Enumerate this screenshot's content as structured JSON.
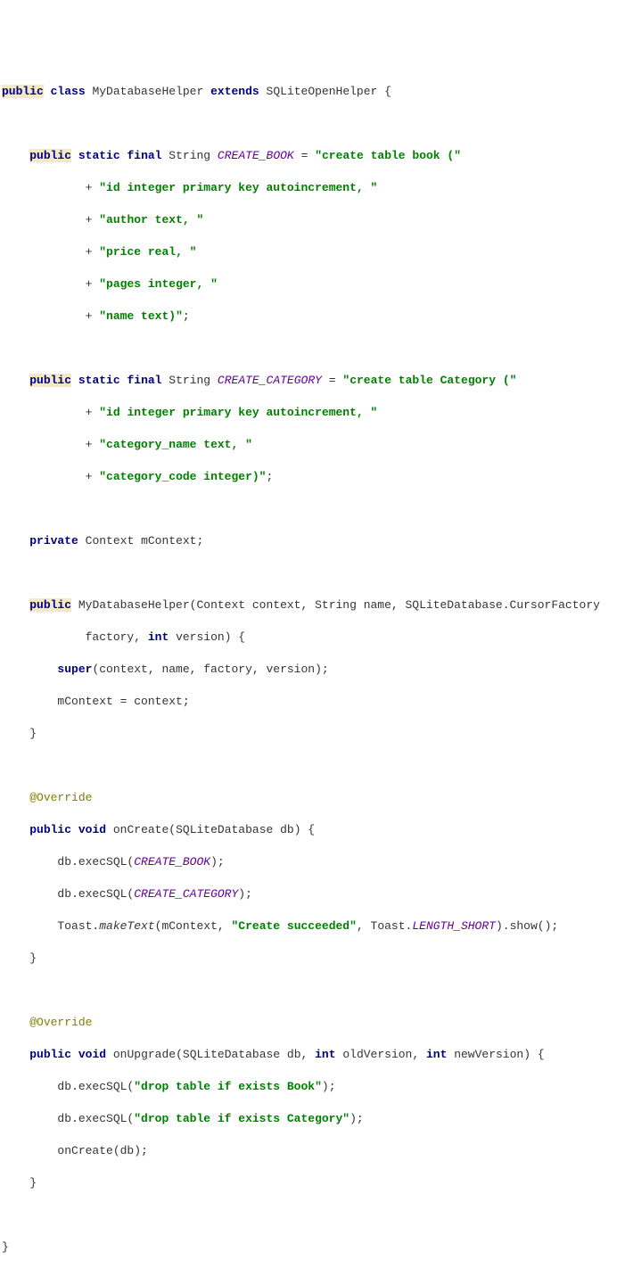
{
  "l1": {
    "public": "public",
    "class": "class",
    "name": "MyDatabaseHelper",
    "extends": "extends",
    "parent": "SQLiteOpenHelper",
    "brace": "{"
  },
  "l3": {
    "public": "public",
    "static": "static",
    "final": "final",
    "type": "String",
    "const": "CREATE_BOOK",
    "eq": "=",
    "s": "\"create table book (\""
  },
  "l4": {
    "plus": "+",
    "s": "\"id integer primary key autoincrement, \""
  },
  "l5": {
    "plus": "+",
    "s": "\"author text, \""
  },
  "l6": {
    "plus": "+",
    "s": "\"price real, \""
  },
  "l7": {
    "plus": "+",
    "s": "\"pages integer, \""
  },
  "l8": {
    "plus": "+",
    "s": "\"name text)\"",
    "semi": ";"
  },
  "l10": {
    "public": "public",
    "static": "static",
    "final": "final",
    "type": "String",
    "const": "CREATE_CATEGORY",
    "eq": "=",
    "s": "\"create table Category (\""
  },
  "l11": {
    "plus": "+",
    "s": "\"id integer primary key autoincrement, \""
  },
  "l12": {
    "plus": "+",
    "s": "\"category_name text, \""
  },
  "l13": {
    "plus": "+",
    "s": "\"category_code integer)\"",
    "semi": ";"
  },
  "l15": {
    "private": "private",
    "type": "Context",
    "name": "mContext;"
  },
  "l17": {
    "public": "public",
    "sig1": "MyDatabaseHelper(Context context, String name, SQLiteDatabase.CursorFactory"
  },
  "l18": {
    "sig2": "factory,",
    "int": "int",
    "rest": "version) {"
  },
  "l19": {
    "super": "super",
    "rest": "(context, name, factory, version);"
  },
  "l20": {
    "rest": "mContext = context;"
  },
  "l21": {
    "brace": "}"
  },
  "l23": {
    "ann": "@Override"
  },
  "l24": {
    "public": "public",
    "void": "void",
    "rest": "onCreate(SQLiteDatabase db) {"
  },
  "l25": {
    "pre": "db.execSQL(",
    "const": "CREATE_BOOK",
    "post": ");"
  },
  "l26": {
    "pre": "db.execSQL(",
    "const": "CREATE_CATEGORY",
    "post": ");"
  },
  "l27": {
    "pre": "Toast.",
    "make": "makeText",
    "open": "(mContext, ",
    "s": "\"Create succeeded\"",
    "mid": ", Toast.",
    "len": "LENGTH_SHORT",
    "post": ").show();"
  },
  "l28": {
    "brace": "}"
  },
  "l30": {
    "ann": "@Override"
  },
  "l31": {
    "public": "public",
    "void": "void",
    "sig1": "onUpgrade(SQLiteDatabase db,",
    "int1": "int",
    "old": "oldVersion,",
    "int2": "int",
    "new": "newVersion) {"
  },
  "l32": {
    "pre": "db.execSQL(",
    "s": "\"drop table if exists Book\"",
    "post": ");"
  },
  "l33": {
    "pre": "db.execSQL(",
    "s": "\"drop table if exists Category\"",
    "post": ");"
  },
  "l34": {
    "rest": "onCreate(db);"
  },
  "l35": {
    "brace": "}"
  },
  "l37": {
    "brace": "}"
  }
}
